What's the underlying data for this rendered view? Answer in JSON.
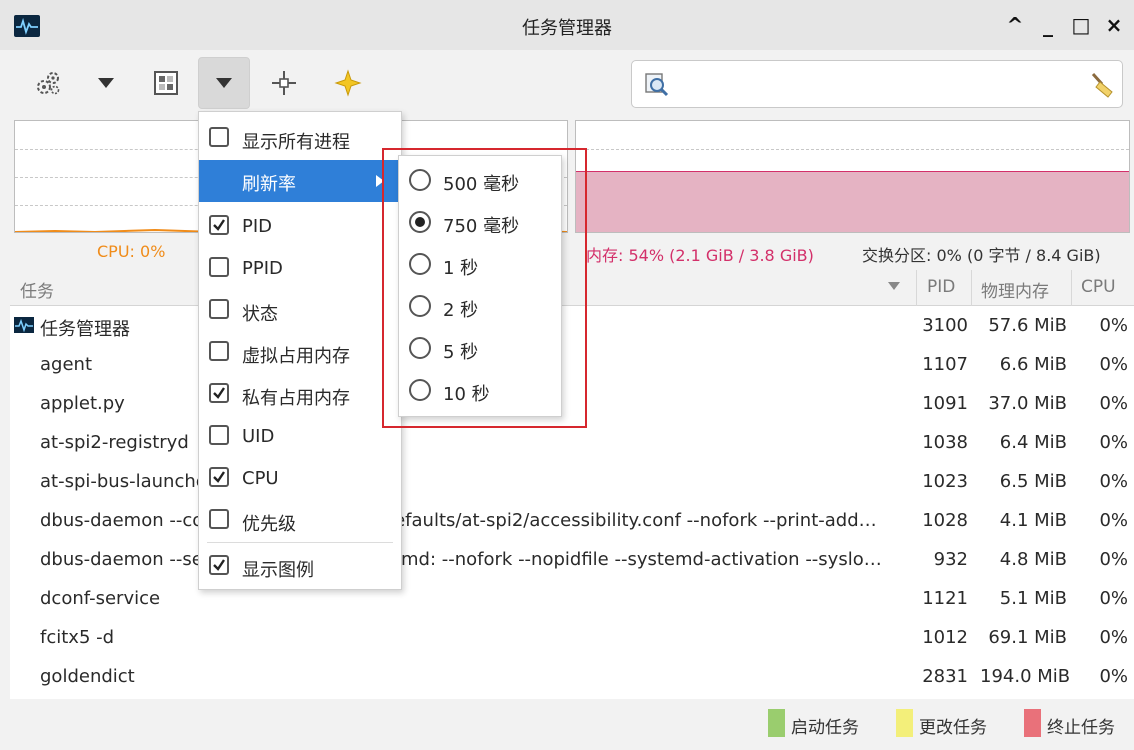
{
  "window": {
    "title": "任务管理器",
    "controls": [
      "^",
      "_",
      "□",
      "×"
    ]
  },
  "search": {
    "placeholder": ""
  },
  "summary": {
    "cpu": "CPU: 0%",
    "memory": "内存: 54% (2.1 GiB / 3.8 GiB)",
    "swap": "交换分区: 0% (0 字节 / 8.4 GiB)",
    "cpu_color": "#f08c1a",
    "memory_color": "#d3306a",
    "memory_fill_color": "#e5b3c3",
    "memory_level": 0.54
  },
  "table": {
    "columns": [
      "任务",
      "PID",
      "物理内存",
      "CPU"
    ],
    "rows": [
      {
        "name": "任务管理器",
        "pid": "3100",
        "mem": "57.6 MiB",
        "cpu": "0%"
      },
      {
        "name": "agent",
        "pid": "1107",
        "mem": "6.6 MiB",
        "cpu": "0%"
      },
      {
        "name": "applet.py",
        "pid": "1091",
        "mem": "37.0 MiB",
        "cpu": "0%"
      },
      {
        "name": "at-spi2-registryd",
        "pid": "1038",
        "mem": "6.4 MiB",
        "cpu": "0%"
      },
      {
        "name": "at-spi-bus-launcher",
        "pid": "1023",
        "mem": "6.5 MiB",
        "cpu": "0%"
      },
      {
        "name": "dbus-daemon --config-file=/usr/share/defaults/at-spi2/accessibility.conf --nofork --print-add…",
        "pid": "1028",
        "mem": "4.1 MiB",
        "cpu": "0%"
      },
      {
        "name": "dbus-daemon --session --address=systemd: --nofork --nopidfile --systemd-activation --syslo…",
        "pid": "932",
        "mem": "4.8 MiB",
        "cpu": "0%"
      },
      {
        "name": "dconf-service",
        "pid": "1121",
        "mem": "5.1 MiB",
        "cpu": "0%"
      },
      {
        "name": "fcitx5 -d",
        "pid": "1012",
        "mem": "69.1 MiB",
        "cpu": "0%"
      },
      {
        "name": "goldendict",
        "pid": "2831",
        "mem": "194.0 MiB",
        "cpu": "0%"
      }
    ]
  },
  "menu": {
    "items": [
      {
        "label": "显示所有进程",
        "checked": false
      },
      {
        "label": "刷新率",
        "submenu": true
      },
      {
        "label": "PID",
        "checked": true
      },
      {
        "label": "PPID",
        "checked": false
      },
      {
        "label": "状态",
        "checked": false
      },
      {
        "label": "虚拟占用内存",
        "checked": false
      },
      {
        "label": "私有占用内存",
        "checked": true
      },
      {
        "label": "UID",
        "checked": false
      },
      {
        "label": "CPU",
        "checked": true
      },
      {
        "label": "优先级",
        "checked": false
      },
      {
        "label": "显示图例",
        "checked": true
      }
    ]
  },
  "refresh_submenu": {
    "options": [
      "500 毫秒",
      "750 毫秒",
      "1 秒",
      "2 秒",
      "5 秒",
      "10 秒"
    ],
    "selected_index": 1
  },
  "statusbar": {
    "legend": [
      {
        "label": "启动任务",
        "color": "#9acd6e"
      },
      {
        "label": "更改任务",
        "color": "#f3ef7a"
      },
      {
        "label": "终止任务",
        "color": "#e9717a"
      }
    ]
  }
}
